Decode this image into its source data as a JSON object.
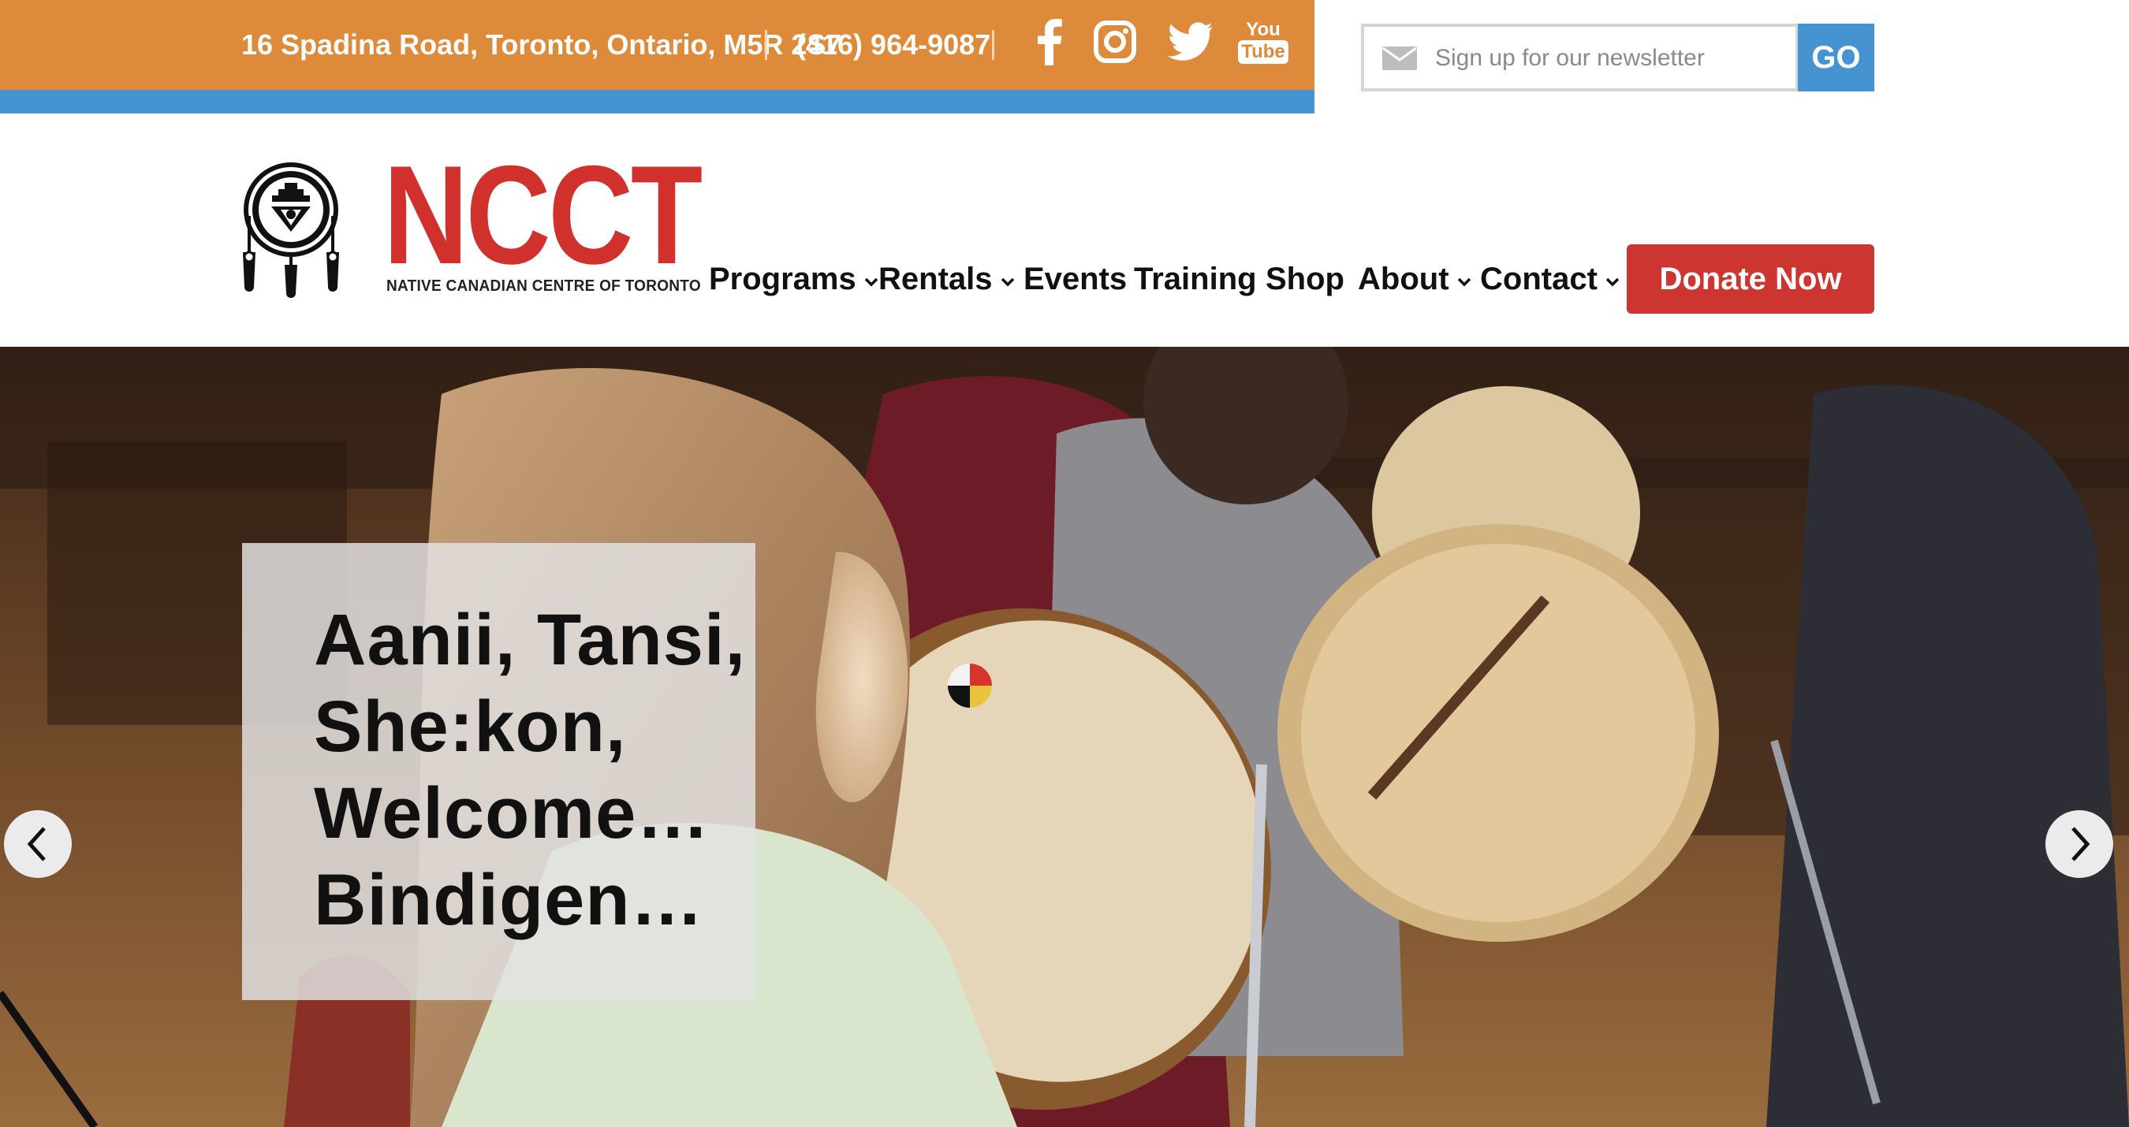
{
  "topbar": {
    "address": "16 Spadina Road, Toronto, Ontario, M5R 2S7",
    "phone": "(416) 964-9087",
    "social": [
      "facebook-icon",
      "instagram-icon",
      "twitter-icon",
      "youtube-icon"
    ],
    "youtube_top": "You",
    "youtube_bottom": "Tube",
    "colors": {
      "orange": "#de8a3b",
      "blue": "#4593d1"
    }
  },
  "newsletter": {
    "placeholder": "Sign up for our newsletter",
    "button": "GO"
  },
  "logo": {
    "title": "NCCT",
    "subtitle": "NATIVE CANADIAN CENTRE OF TORONTO",
    "color": "#d0312d"
  },
  "nav": {
    "items": [
      {
        "label": "Programs",
        "dropdown": true
      },
      {
        "label": "Rentals",
        "dropdown": true
      },
      {
        "label": "Events",
        "dropdown": false
      },
      {
        "label": "Training",
        "dropdown": false
      },
      {
        "label": "Shop",
        "dropdown": false
      },
      {
        "label": "About",
        "dropdown": true
      },
      {
        "label": "Contact",
        "dropdown": true
      }
    ],
    "donate": "Donate Now"
  },
  "hero": {
    "lines": [
      "Aanii, Tansi,",
      "She:kon,",
      "Welcome…",
      "Bindigen…"
    ],
    "prev": "chevron-left-icon",
    "next": "chevron-right-icon"
  }
}
